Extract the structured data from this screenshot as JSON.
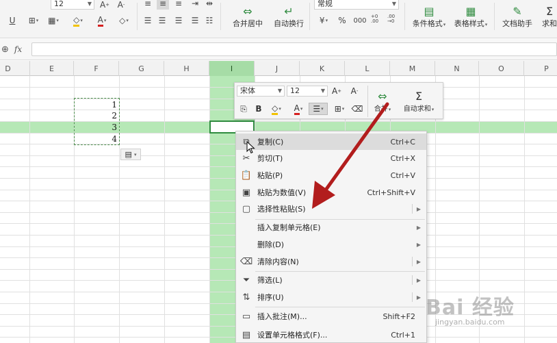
{
  "ribbon": {
    "font_size": "12",
    "number_format": "常规",
    "merge_center": "合并居中",
    "auto_wrap": "自动换行",
    "percent": "%",
    "thousands": "000",
    "decimals_inc": "+0 .00",
    "decimals_dec": ".00 →0",
    "conditional_format": "条件格式",
    "table_style": "表格样式",
    "doc_assistant": "文档助手",
    "sum_partial": "求和"
  },
  "formula_bar": {
    "fx_label": "fx",
    "value": ""
  },
  "columns": [
    "D",
    "E",
    "F",
    "G",
    "H",
    "I",
    "J",
    "K",
    "L",
    "M",
    "N",
    "O",
    "P"
  ],
  "selected_column": "I",
  "cells": {
    "f1": "1",
    "f2": "2",
    "f3": "3",
    "f4": "4"
  },
  "mini_toolbar": {
    "font_name": "宋体",
    "font_size": "12",
    "bold": "B",
    "merge_label": "合并",
    "autosum_label": "自动求和"
  },
  "context_menu": {
    "items": [
      {
        "label": "复制(C)",
        "shortcut": "Ctrl+C",
        "icon": "copy-icon"
      },
      {
        "label": "剪切(T)",
        "shortcut": "Ctrl+X",
        "icon": "scissors-icon"
      },
      {
        "label": "粘贴(P)",
        "shortcut": "Ctrl+V",
        "icon": "paste-icon"
      },
      {
        "label": "粘贴为数值(V)",
        "shortcut": "Ctrl+Shift+V",
        "icon": "paste-values-icon"
      },
      {
        "label": "选择性粘贴(S)",
        "shortcut": "",
        "icon": "paste-special-icon"
      },
      {
        "label": "插入复制单元格(E)",
        "shortcut": "",
        "icon": ""
      },
      {
        "label": "删除(D)",
        "shortcut": "",
        "icon": ""
      },
      {
        "label": "清除内容(N)",
        "shortcut": "",
        "icon": "eraser-icon"
      },
      {
        "label": "筛选(L)",
        "shortcut": "",
        "icon": "filter-icon"
      },
      {
        "label": "排序(U)",
        "shortcut": "",
        "icon": "sort-icon"
      },
      {
        "label": "插入批注(M)...",
        "shortcut": "Shift+F2",
        "icon": "comment-icon"
      },
      {
        "label": "设置单元格格式(F)...",
        "shortcut": "Ctrl+1",
        "icon": "format-cells-icon"
      }
    ]
  },
  "watermark": {
    "logo": "Bai 经验",
    "url": "jingyan.baidu.com"
  },
  "colors": {
    "selection_green": "#b6e8b6",
    "active_border": "#2f8b3f",
    "arrow_red": "#b21d1d"
  }
}
